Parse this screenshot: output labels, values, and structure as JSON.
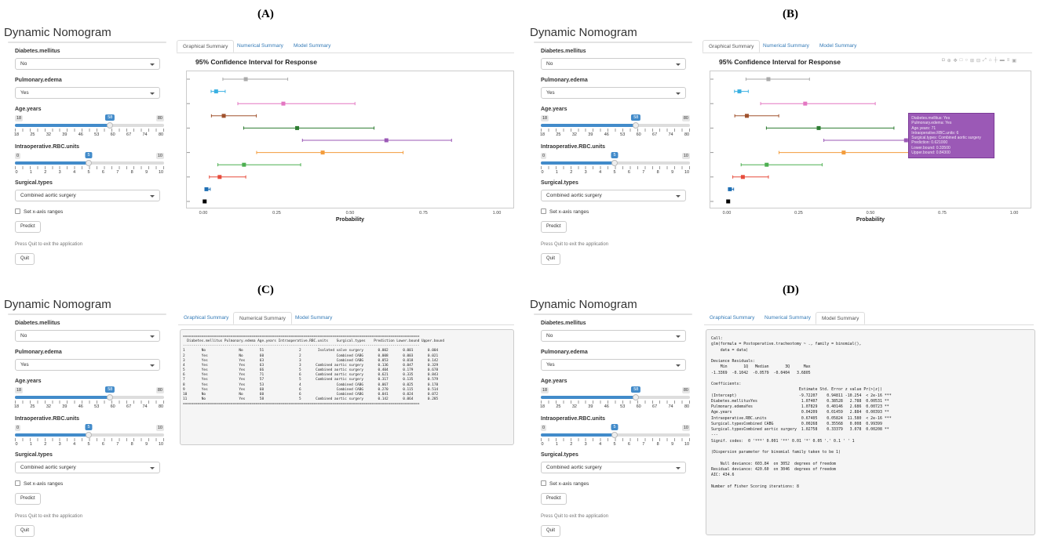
{
  "figure_letters": [
    "(A)",
    "(B)",
    "(C)",
    "(D)"
  ],
  "app": {
    "title": "Dynamic Nomogram",
    "diabetes_label": "Diabetes.mellitus",
    "diabetes_value": "No",
    "pulmonary_label": "Pulmonary.edema",
    "pulmonary_value": "Yes",
    "age_label": "Age.years",
    "age_slider": {
      "min": "18",
      "max": "80",
      "value": "58",
      "ticks": [
        "18",
        "25",
        "32",
        "39",
        "46",
        "53",
        "60",
        "67",
        "74",
        "80"
      ]
    },
    "rbc_label": "Intraoperative.RBC.units",
    "rbc_slider": {
      "min": "0",
      "max": "10",
      "value": "5",
      "ticks": [
        "0",
        "1",
        "2",
        "3",
        "4",
        "5",
        "6",
        "7",
        "8",
        "9",
        "10"
      ]
    },
    "surgical_label": "Surgical.types",
    "surgical_value": "Combined aortic surgery",
    "checkbox_label": "Set x-axis ranges",
    "predict_label": "Predict",
    "quit_note": "Press Quit to exit the application",
    "quit_label": "Quit"
  },
  "tabs": [
    "Graphical Summary",
    "Numerical Summary",
    "Model Summary"
  ],
  "graph": {
    "title": "95% Confidence Interval for Response",
    "xlabel": "Probability",
    "x_ticks": [
      "0.00",
      "0.25",
      "0.50",
      "0.75",
      "1.00"
    ]
  },
  "chart_data": {
    "type": "scatter",
    "title": "95% Confidence Interval for Response",
    "xlabel": "Probability",
    "xlim": [
      0,
      1
    ],
    "points": [
      {
        "estimate": 0.142,
        "lower": 0.064,
        "upper": 0.285,
        "color": "#aaaaaa"
      },
      {
        "estimate": 0.041,
        "lower": 0.024,
        "upper": 0.072,
        "color": "#3ab0e2"
      },
      {
        "estimate": 0.27,
        "lower": 0.115,
        "upper": 0.514,
        "color": "#e377c2"
      },
      {
        "estimate": 0.067,
        "lower": 0.025,
        "upper": 0.178,
        "color": "#a0522d"
      },
      {
        "estimate": 0.317,
        "lower": 0.135,
        "upper": 0.579,
        "color": "#2e7d32"
      },
      {
        "estimate": 0.621,
        "lower": 0.335,
        "upper": 0.843,
        "color": "#9b59b6"
      },
      {
        "estimate": 0.404,
        "lower": 0.179,
        "upper": 0.678,
        "color": "#f39c3c"
      },
      {
        "estimate": 0.136,
        "lower": 0.047,
        "upper": 0.329,
        "color": "#4caf50"
      },
      {
        "estimate": 0.053,
        "lower": 0.018,
        "upper": 0.142,
        "color": "#e74c3c"
      },
      {
        "estimate": 0.008,
        "lower": 0.003,
        "upper": 0.021,
        "color": "#1f6fb4"
      },
      {
        "estimate": 0.002,
        "lower": 0.001,
        "upper": 0.004,
        "color": "#000000"
      }
    ]
  },
  "tooltip": {
    "lines": [
      "Diabetes.mellitus: Yes",
      "Pulmonary.edema: Yes",
      "Age.years: 71",
      "Intraoperative.RBC.units: 6",
      "Surgical.types: Combined aortic surgery",
      "Prediction: 0.621000",
      "Lower.bound: 0.33500",
      "Upper.bound: 0.84300"
    ]
  },
  "numerical_text": "==================================================================================================================\n  Diabetes.mellitus Pulmonary.edema Age.years Intraoperative.RBC.units    Surgical.types    Prediction Lower.bound Upper.bound\n------------------------------------------------------------------------------------------------------------------\n1        No                No        51                 2        Isolated valve surgery       0.002       0.001       0.004\n2        Yes               No        60                 2                 Combined CABG       0.008       0.003       0.021\n3        Yes               Yes       63                 3                 Combined CABG       0.053       0.018       0.142\n4        Yes               Yes       63                 3       Combined aortic surgery       0.136       0.047       0.329\n5        Yes               Yes       66                 5       Combined aortic surgery       0.404       0.179       0.678\n6        Yes               Yes       71                 6       Combined aortic surgery       0.621       0.335       0.843\n7        Yes               Yes       57                 5       Combined aortic surgery       0.317       0.135       0.579\n8        Yes               Yes       53                 4                 Combined CABG       0.067       0.025       0.178\n9        Yes               Yes       60                 6                 Combined CABG       0.270       0.115       0.514\n10       No                No        60                 6                 Combined CABG       0.041       0.024       0.072\n11       No                Yes       58                 5       Combined aortic surgery       0.142       0.064       0.285\n==================================================================================================================",
  "model_text": "Call:\nglm(formula = Postoperative.tracheotomy ~ ., family = binomial(),\n    data = data)\n\nDeviance Residuals:\n    Min       1Q   Median       3Q      Max\n-1.3369  -0.1042  -0.0579  -0.0404   3.6805\n\nCoefficients:\n                                      Estimate Std. Error z value Pr(>|z|)\n(Intercept)                           -9.72207    0.94811 -10.254  < 2e-16 ***\nDiabetes.mellitusYes                   1.07407    0.38528   2.788  0.00531 **\nPulmonary.edemaYes                     1.07829    0.40146   2.686  0.00723 **\nAge.years                              0.04209    0.01459   2.884  0.00393 **\nIntraoperative.RBC.units               0.67405    0.05824  11.580  < 2e-16 ***\nSurgical.typesCombined CABG            0.00268    0.35568   0.008  0.99399\nSurgical.typesCombined aortic surgery  1.02758    0.33379   3.078  0.00208 **\n---\nSignif. codes:  0 '***' 0.001 '**' 0.01 '*' 0.05 '.' 0.1 ' ' 1\n\n(Dispersion parameter for binomial family taken to be 1)\n\n    Null deviance: 603.84  on 3052  degrees of freedom\nResidual deviance: 420.60  on 3046  degrees of freedom\nAIC: 434.6\n\nNumber of Fisher Scoring iterations: 8"
}
